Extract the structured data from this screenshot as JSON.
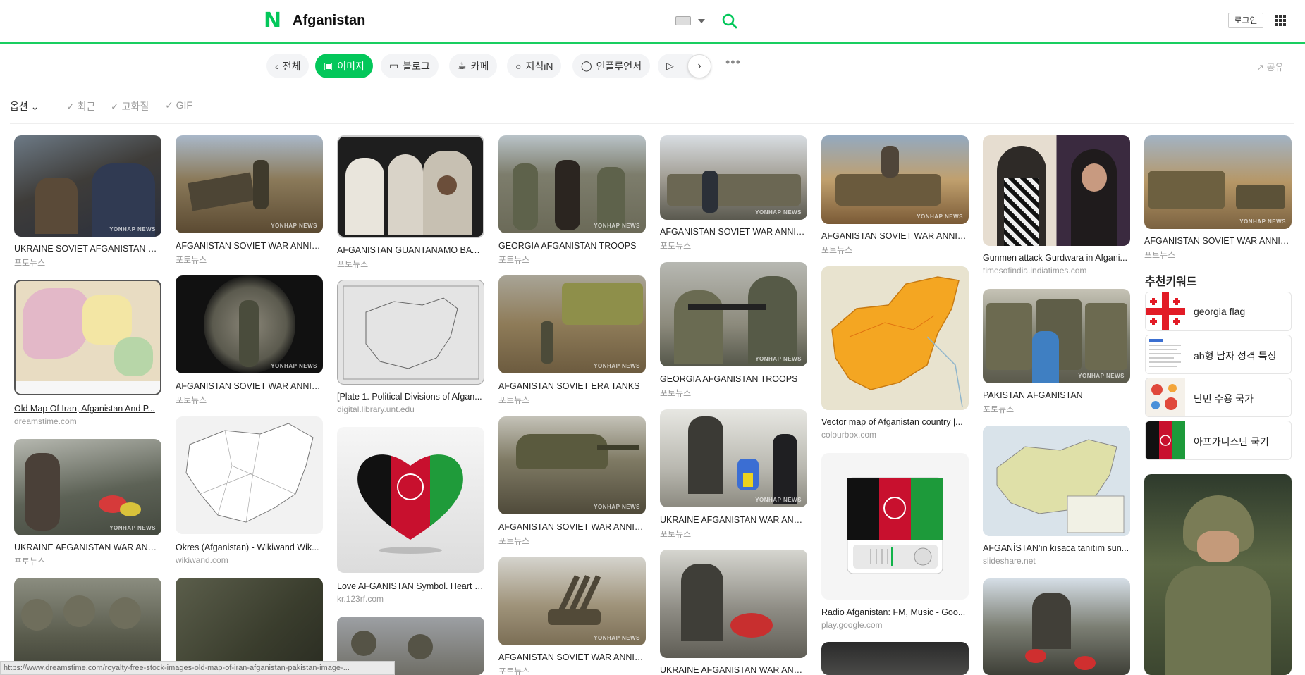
{
  "header": {
    "query": "Afganistan",
    "login_label": "로그인"
  },
  "tabs": [
    {
      "label": "전체"
    },
    {
      "label": "이미지"
    },
    {
      "label": "블로그"
    },
    {
      "label": "카페"
    },
    {
      "label": "지식iN"
    },
    {
      "label": "인플루언서"
    }
  ],
  "share_label": "공유",
  "options": {
    "main": "옵션",
    "recent": "최근",
    "hires": "고화질",
    "gif": "GIF"
  },
  "images": [
    {
      "caption": "UKRAINE SOVIET AFGANISTAN W...",
      "source": "포토뉴스"
    },
    {
      "caption": "Old Map Of Iran, Afganistan And P...",
      "source": "dreamstime.com"
    },
    {
      "caption": "UKRAINE AFGANISTAN WAR ANNI...",
      "source": "포토뉴스"
    },
    {
      "caption": "AFGANISTAN SOVIET WAR ANNIV...",
      "source": "포토뉴스"
    },
    {
      "caption": "AFGANISTAN SOVIET WAR ANNIV...",
      "source": "포토뉴스"
    },
    {
      "caption": "Okres (Afganistan) - Wikiwand Wik...",
      "source": "wikiwand.com"
    },
    {
      "caption": "AFGANISTAN GUANTANAMO BAY ...",
      "source": "포토뉴스"
    },
    {
      "caption": "[Plate 1. Political Divisions of Afgan...",
      "source": "digital.library.unt.edu"
    },
    {
      "caption": "Love AFGANISTAN Symbol. Heart F...",
      "source": "kr.123rf.com"
    },
    {
      "caption": "GEORGIA AFGANISTAN TROOPS",
      "source": "포토뉴스"
    },
    {
      "caption": "AFGANISTAN SOVIET ERA TANKS",
      "source": "포토뉴스"
    },
    {
      "caption": "AFGANISTAN SOVIET WAR ANNIV...",
      "source": "포토뉴스"
    },
    {
      "caption": "AFGANISTAN SOVIET WAR ANNIV...",
      "source": "포토뉴스"
    },
    {
      "caption": "AFGANISTAN SOVIET WAR ANNIV...",
      "source": "포토뉴스"
    },
    {
      "caption": "GEORGIA AFGANISTAN TROOPS",
      "source": "포토뉴스"
    },
    {
      "caption": "UKRAINE AFGANISTAN WAR ANNI...",
      "source": "포토뉴스"
    },
    {
      "caption": "UKRAINE AFGANISTAN WAR ANNI...",
      "source": ""
    },
    {
      "caption": "AFGANISTAN SOVIET WAR ANNIV...",
      "source": "포토뉴스"
    },
    {
      "caption": "Vector map of Afganistan country |...",
      "source": "colourbox.com"
    },
    {
      "caption": "Radio Afganistan: FM, Music - Goo...",
      "source": "play.google.com"
    },
    {
      "caption": "Gunmen attack Gurdwara in Afgani...",
      "source": "timesofindia.indiatimes.com"
    },
    {
      "caption": "PAKISTAN AFGANISTAN",
      "source": "포토뉴스"
    },
    {
      "caption": "AFGANİSTAN'ın kısaca tanıtım sun...",
      "source": "slideshare.net"
    },
    {
      "caption": "AFGANISTAN SOVIET WAR ANNIV...",
      "source": "포토뉴스"
    }
  ],
  "watermark": "YONHAP NEWS",
  "recommended": {
    "title": "추천키워드",
    "items": [
      {
        "label": "georgia flag"
      },
      {
        "label": "ab형 남자 성격 특징"
      },
      {
        "label": "난민 수용 국가"
      },
      {
        "label": "아프가니스탄 국기"
      }
    ]
  },
  "statusbar": "https://www.dreamstime.com/royalty-free-stock-images-old-map-of-iran-afganistan-pakistan-image-..."
}
